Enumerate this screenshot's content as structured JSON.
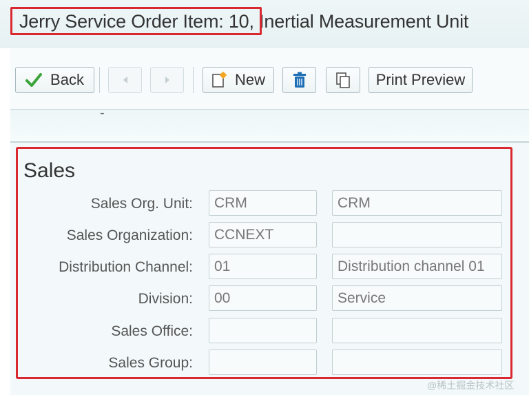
{
  "header": {
    "title": "Jerry Service Order Item: 10, Inertial Measurement Unit"
  },
  "toolbar": {
    "back_label": "Back",
    "new_label": "New",
    "print_preview_label": "Print Preview"
  },
  "section": {
    "title": "Sales",
    "fields": [
      {
        "label": "Sales Org. Unit:",
        "value1": "CRM",
        "value2": "CRM"
      },
      {
        "label": "Sales Organization:",
        "value1": "CCNEXT",
        "value2": ""
      },
      {
        "label": "Distribution Channel:",
        "value1": "01",
        "value2": "Distribution channel 01"
      },
      {
        "label": "Division:",
        "value1": "00",
        "value2": "Service"
      },
      {
        "label": "Sales Office:",
        "value1": "",
        "value2": ""
      },
      {
        "label": "Sales Group:",
        "value1": "",
        "value2": ""
      }
    ]
  },
  "colors": {
    "highlight": "#d9282f",
    "check_green": "#3aa43a",
    "delete_blue": "#1f6fb5"
  },
  "icons": [
    "checkmark-icon",
    "arrow-left-icon",
    "arrow-right-icon",
    "new-document-icon",
    "trash-icon",
    "copy-icon"
  ]
}
